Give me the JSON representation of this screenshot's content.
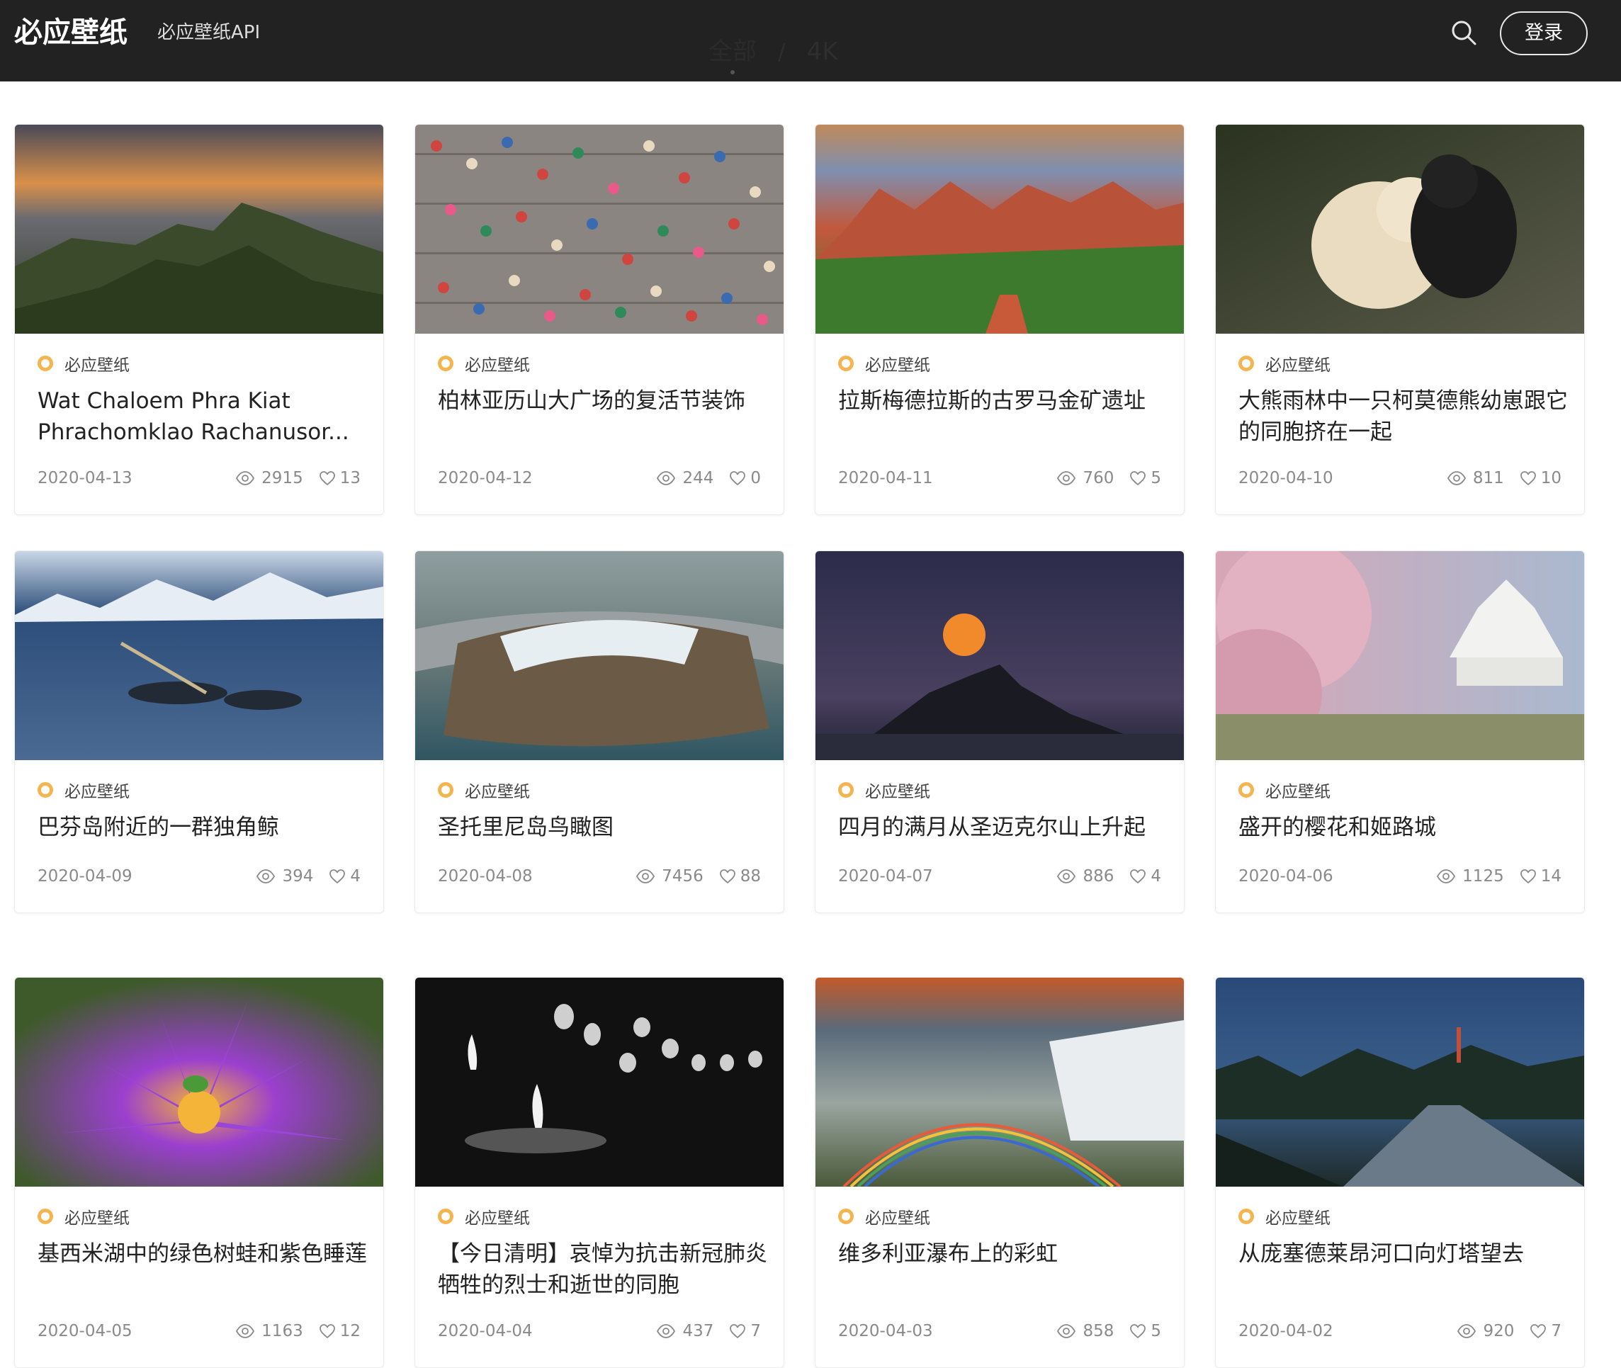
{
  "header": {
    "logo": "必应壁纸",
    "api_link": "必应壁纸API",
    "tabs": [
      {
        "label": "全部",
        "active": true
      },
      {
        "label": "4K",
        "active": false
      }
    ],
    "tab_separator": "/",
    "search_icon": "search-icon",
    "login_label": "登录"
  },
  "colors": {
    "header_bg": "#222222",
    "source_dot": "#f6b44f",
    "meta_text": "#8a8a8a"
  },
  "cards": [
    {
      "source": "必应壁纸",
      "title": "Wat Chaloem Phra Kiat Phrachomklao Rachanusor...",
      "date": "2020-04-13",
      "views": "2915",
      "likes": "13"
    },
    {
      "source": "必应壁纸",
      "title": "柏林亚历山大广场的复活节装饰",
      "date": "2020-04-12",
      "views": "244",
      "likes": "0"
    },
    {
      "source": "必应壁纸",
      "title": "拉斯梅德拉斯的古罗马金矿遗址",
      "date": "2020-04-11",
      "views": "760",
      "likes": "5"
    },
    {
      "source": "必应壁纸",
      "title": "大熊雨林中一只柯莫德熊幼崽跟它的同胞挤在一起",
      "date": "2020-04-10",
      "views": "811",
      "likes": "10"
    },
    {
      "source": "必应壁纸",
      "title": "巴芬岛附近的一群独角鲸",
      "date": "2020-04-09",
      "views": "394",
      "likes": "4"
    },
    {
      "source": "必应壁纸",
      "title": "圣托里尼岛鸟瞰图",
      "date": "2020-04-08",
      "views": "7456",
      "likes": "88"
    },
    {
      "source": "必应壁纸",
      "title": "四月的满月从圣迈克尔山上升起",
      "date": "2020-04-07",
      "views": "886",
      "likes": "4"
    },
    {
      "source": "必应壁纸",
      "title": "盛开的樱花和姬路城",
      "date": "2020-04-06",
      "views": "1125",
      "likes": "14"
    },
    {
      "source": "必应壁纸",
      "title": "基西米湖中的绿色树蛙和紫色睡莲",
      "date": "2020-04-05",
      "views": "1163",
      "likes": "12"
    },
    {
      "source": "必应壁纸",
      "title": "【今日清明】哀悼为抗击新冠肺炎牺牲的烈士和逝世的同胞",
      "date": "2020-04-04",
      "views": "437",
      "likes": "7"
    },
    {
      "source": "必应壁纸",
      "title": "维多利亚瀑布上的彩虹",
      "date": "2020-04-03",
      "views": "858",
      "likes": "5"
    },
    {
      "source": "必应壁纸",
      "title": "从庞塞德莱昂河口向灯塔望去",
      "date": "2020-04-02",
      "views": "920",
      "likes": "7"
    }
  ]
}
